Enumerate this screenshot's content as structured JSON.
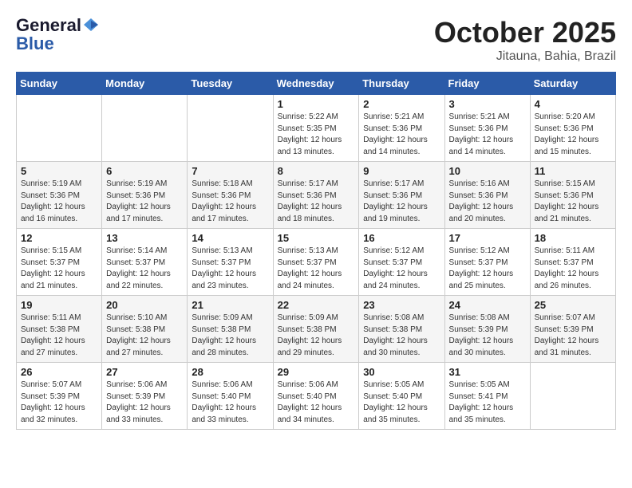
{
  "header": {
    "logo_line1": "General",
    "logo_line2": "Blue",
    "month": "October 2025",
    "location": "Jitauna, Bahia, Brazil"
  },
  "days_of_week": [
    "Sunday",
    "Monday",
    "Tuesday",
    "Wednesday",
    "Thursday",
    "Friday",
    "Saturday"
  ],
  "weeks": [
    [
      {
        "day": "",
        "info": ""
      },
      {
        "day": "",
        "info": ""
      },
      {
        "day": "",
        "info": ""
      },
      {
        "day": "1",
        "info": "Sunrise: 5:22 AM\nSunset: 5:35 PM\nDaylight: 12 hours\nand 13 minutes."
      },
      {
        "day": "2",
        "info": "Sunrise: 5:21 AM\nSunset: 5:36 PM\nDaylight: 12 hours\nand 14 minutes."
      },
      {
        "day": "3",
        "info": "Sunrise: 5:21 AM\nSunset: 5:36 PM\nDaylight: 12 hours\nand 14 minutes."
      },
      {
        "day": "4",
        "info": "Sunrise: 5:20 AM\nSunset: 5:36 PM\nDaylight: 12 hours\nand 15 minutes."
      }
    ],
    [
      {
        "day": "5",
        "info": "Sunrise: 5:19 AM\nSunset: 5:36 PM\nDaylight: 12 hours\nand 16 minutes."
      },
      {
        "day": "6",
        "info": "Sunrise: 5:19 AM\nSunset: 5:36 PM\nDaylight: 12 hours\nand 17 minutes."
      },
      {
        "day": "7",
        "info": "Sunrise: 5:18 AM\nSunset: 5:36 PM\nDaylight: 12 hours\nand 17 minutes."
      },
      {
        "day": "8",
        "info": "Sunrise: 5:17 AM\nSunset: 5:36 PM\nDaylight: 12 hours\nand 18 minutes."
      },
      {
        "day": "9",
        "info": "Sunrise: 5:17 AM\nSunset: 5:36 PM\nDaylight: 12 hours\nand 19 minutes."
      },
      {
        "day": "10",
        "info": "Sunrise: 5:16 AM\nSunset: 5:36 PM\nDaylight: 12 hours\nand 20 minutes."
      },
      {
        "day": "11",
        "info": "Sunrise: 5:15 AM\nSunset: 5:36 PM\nDaylight: 12 hours\nand 21 minutes."
      }
    ],
    [
      {
        "day": "12",
        "info": "Sunrise: 5:15 AM\nSunset: 5:37 PM\nDaylight: 12 hours\nand 21 minutes."
      },
      {
        "day": "13",
        "info": "Sunrise: 5:14 AM\nSunset: 5:37 PM\nDaylight: 12 hours\nand 22 minutes."
      },
      {
        "day": "14",
        "info": "Sunrise: 5:13 AM\nSunset: 5:37 PM\nDaylight: 12 hours\nand 23 minutes."
      },
      {
        "day": "15",
        "info": "Sunrise: 5:13 AM\nSunset: 5:37 PM\nDaylight: 12 hours\nand 24 minutes."
      },
      {
        "day": "16",
        "info": "Sunrise: 5:12 AM\nSunset: 5:37 PM\nDaylight: 12 hours\nand 24 minutes."
      },
      {
        "day": "17",
        "info": "Sunrise: 5:12 AM\nSunset: 5:37 PM\nDaylight: 12 hours\nand 25 minutes."
      },
      {
        "day": "18",
        "info": "Sunrise: 5:11 AM\nSunset: 5:37 PM\nDaylight: 12 hours\nand 26 minutes."
      }
    ],
    [
      {
        "day": "19",
        "info": "Sunrise: 5:11 AM\nSunset: 5:38 PM\nDaylight: 12 hours\nand 27 minutes."
      },
      {
        "day": "20",
        "info": "Sunrise: 5:10 AM\nSunset: 5:38 PM\nDaylight: 12 hours\nand 27 minutes."
      },
      {
        "day": "21",
        "info": "Sunrise: 5:09 AM\nSunset: 5:38 PM\nDaylight: 12 hours\nand 28 minutes."
      },
      {
        "day": "22",
        "info": "Sunrise: 5:09 AM\nSunset: 5:38 PM\nDaylight: 12 hours\nand 29 minutes."
      },
      {
        "day": "23",
        "info": "Sunrise: 5:08 AM\nSunset: 5:38 PM\nDaylight: 12 hours\nand 30 minutes."
      },
      {
        "day": "24",
        "info": "Sunrise: 5:08 AM\nSunset: 5:39 PM\nDaylight: 12 hours\nand 30 minutes."
      },
      {
        "day": "25",
        "info": "Sunrise: 5:07 AM\nSunset: 5:39 PM\nDaylight: 12 hours\nand 31 minutes."
      }
    ],
    [
      {
        "day": "26",
        "info": "Sunrise: 5:07 AM\nSunset: 5:39 PM\nDaylight: 12 hours\nand 32 minutes."
      },
      {
        "day": "27",
        "info": "Sunrise: 5:06 AM\nSunset: 5:39 PM\nDaylight: 12 hours\nand 33 minutes."
      },
      {
        "day": "28",
        "info": "Sunrise: 5:06 AM\nSunset: 5:40 PM\nDaylight: 12 hours\nand 33 minutes."
      },
      {
        "day": "29",
        "info": "Sunrise: 5:06 AM\nSunset: 5:40 PM\nDaylight: 12 hours\nand 34 minutes."
      },
      {
        "day": "30",
        "info": "Sunrise: 5:05 AM\nSunset: 5:40 PM\nDaylight: 12 hours\nand 35 minutes."
      },
      {
        "day": "31",
        "info": "Sunrise: 5:05 AM\nSunset: 5:41 PM\nDaylight: 12 hours\nand 35 minutes."
      },
      {
        "day": "",
        "info": ""
      }
    ]
  ]
}
